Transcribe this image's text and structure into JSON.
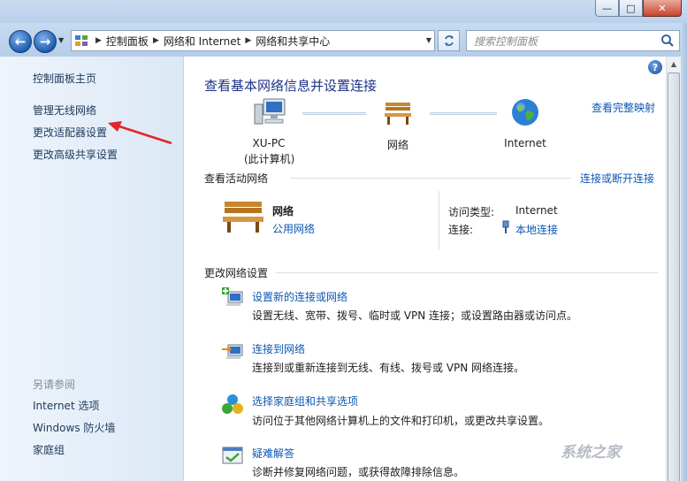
{
  "window": {
    "minimize_glyph": "—",
    "maximize_glyph": "□",
    "close_glyph": "✕"
  },
  "address": {
    "crumbs": [
      "控制面板",
      "网络和 Internet",
      "网络和共享中心"
    ]
  },
  "search": {
    "placeholder": "搜索控制面板"
  },
  "sidebar": {
    "items": [
      {
        "label": "控制面板主页"
      },
      {
        "label": "管理无线网络"
      },
      {
        "label": "更改适配器设置"
      },
      {
        "label": "更改高级共享设置"
      }
    ],
    "see_also_label": "另请参阅",
    "see_also": [
      {
        "label": "Internet 选项"
      },
      {
        "label": "Windows 防火墙"
      },
      {
        "label": "家庭组"
      }
    ]
  },
  "main": {
    "title": "查看基本网络信息并设置连接",
    "full_map_link": "查看完整映射",
    "map": {
      "computer_name": "XU-PC",
      "computer_sub": "(此计算机)",
      "network": "网络",
      "internet": "Internet"
    },
    "active": {
      "section_title": "查看活动网络",
      "connect_link": "连接或断开连接",
      "network_name": "网络",
      "network_type": "公用网络",
      "access_type_label": "访问类型:",
      "access_type_value": "Internet",
      "connection_label": "连接:",
      "connection_value": "本地连接"
    },
    "change": {
      "section_title": "更改网络设置",
      "tasks": [
        {
          "title": "设置新的连接或网络",
          "desc": "设置无线、宽带、拨号、临时或 VPN 连接；或设置路由器或访问点。"
        },
        {
          "title": "连接到网络",
          "desc": "连接到或重新连接到无线、有线、拨号或 VPN 网络连接。"
        },
        {
          "title": "选择家庭组和共享选项",
          "desc": "访问位于其他网络计算机上的文件和打印机，或更改共享设置。"
        },
        {
          "title": "疑难解答",
          "desc": "诊断并修复网络问题，或获得故障排除信息。"
        }
      ]
    }
  },
  "watermark": "系统之家"
}
